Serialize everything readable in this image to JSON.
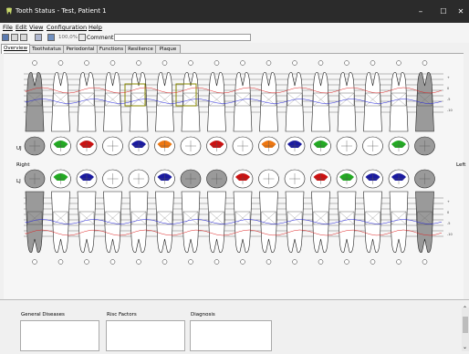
{
  "window": {
    "title": "Tooth Status - Test, Patient 1",
    "minimize_glyph": "–",
    "maximize_glyph": "☐",
    "close_glyph": "✕"
  },
  "menu": [
    "File",
    "Edit",
    "View",
    "Configuration",
    "Help"
  ],
  "toolbar": {
    "zoom": "100,0%",
    "comment_label": "Comment:",
    "comment_value": ""
  },
  "tabs": [
    {
      "label": "Overview",
      "active": true
    },
    {
      "label": "Toothstatus",
      "active": false
    },
    {
      "label": "Periodontal",
      "active": false
    },
    {
      "label": "Functions",
      "active": false
    },
    {
      "label": "Resilience",
      "active": false
    },
    {
      "label": "Plaque",
      "active": false
    }
  ],
  "chart": {
    "left_label": "Right",
    "right_label": "Left",
    "upper_row_label": "UJ",
    "lower_row_label": "LJ",
    "depth_labels": [
      "+",
      "0",
      "-5",
      "-10"
    ],
    "colors": {
      "restoration_red": "#cc1111",
      "restoration_green": "#22aa22",
      "restoration_blue": "#1a1aa0",
      "restoration_orange": "#ee7711",
      "gray": "#9a9a9a",
      "probing_red": "#dd2222",
      "probing_blue": "#2222dd"
    }
  },
  "bottom": {
    "general_diseases": "General Diseases",
    "risk_factors": "Risc Factors",
    "diagnosis": "Diagnosis"
  },
  "scroll_up": "⌃",
  "scroll_down": "⌄"
}
